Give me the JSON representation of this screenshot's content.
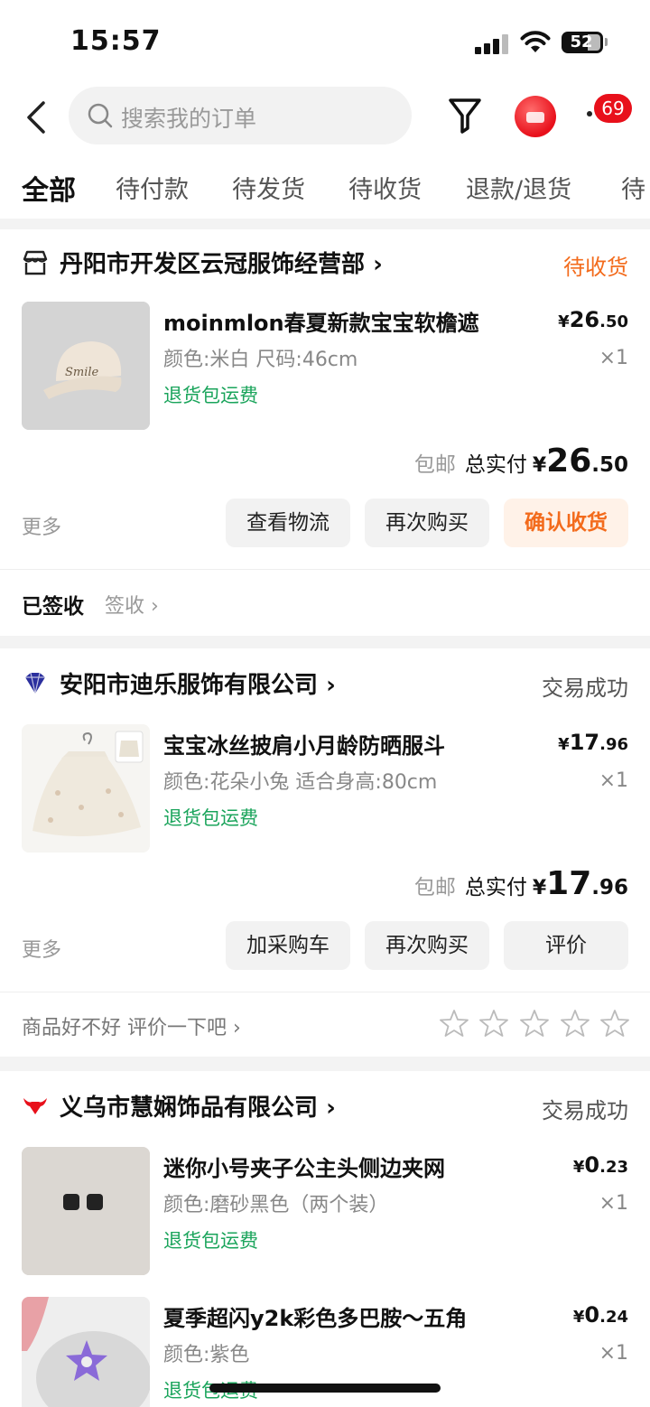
{
  "status_bar": {
    "time": "15:57",
    "battery": "52"
  },
  "header": {
    "search_placeholder": "搜索我的订单",
    "badge_count": "69",
    "tabs": [
      "全部",
      "待付款",
      "待发货",
      "待收货",
      "退款/退货",
      "待"
    ]
  },
  "orders": [
    {
      "shop": "丹阳市开发区云冠服饰经营部",
      "status": "待收货",
      "items": [
        {
          "title": "moinmlon春夏新款宝宝软檐遮",
          "spec": "颜色:米白 尺码:46cm",
          "tag": "退货包运费",
          "price_yen": "¥",
          "price_int": "26",
          "price_dec": ".50",
          "qty": "×1"
        }
      ],
      "free_shipping": "包邮",
      "total_label": "总实付",
      "total_yen": "¥",
      "total_int": "26",
      "total_dec": ".50",
      "more": "更多",
      "buttons": [
        "查看物流",
        "再次购买",
        "确认收货"
      ],
      "signed_label": "已签收",
      "signed_link": "签收"
    },
    {
      "shop": "安阳市迪乐服饰有限公司",
      "status": "交易成功",
      "items": [
        {
          "title": "宝宝冰丝披肩小月龄防晒服斗",
          "spec": "颜色:花朵小兔 适合身高:80cm",
          "tag": "退货包运费",
          "price_yen": "¥",
          "price_int": "17",
          "price_dec": ".96",
          "qty": "×1"
        }
      ],
      "free_shipping": "包邮",
      "total_label": "总实付",
      "total_yen": "¥",
      "total_int": "17",
      "total_dec": ".96",
      "more": "更多",
      "buttons": [
        "加采购车",
        "再次购买",
        "评价"
      ],
      "review_prompt": "商品好不好 评价一下吧",
      "rating_stars": 0
    },
    {
      "shop": "义乌市慧娴饰品有限公司",
      "status": "交易成功",
      "items": [
        {
          "title": "迷你小号夹子公主头侧边夹网",
          "spec": "颜色:磨砂黑色（两个装）",
          "tag": "退货包运费",
          "price_yen": "¥",
          "price_int": "0",
          "price_dec": ".23",
          "qty": "×1"
        },
        {
          "title": "夏季超闪y2k彩色多巴胺～五角",
          "spec": "颜色:紫色",
          "tag": "退货包运费",
          "price_yen": "¥",
          "price_int": "0",
          "price_dec": ".24",
          "qty": "×1"
        }
      ]
    }
  ],
  "colors": {
    "accent": "#f36b1c",
    "tag_green": "#1aa45b",
    "badge_red": "#e8101b"
  }
}
